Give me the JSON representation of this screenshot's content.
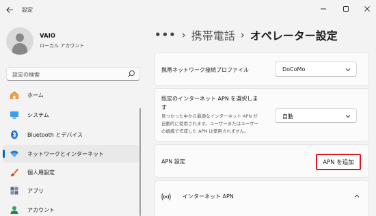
{
  "window": {
    "title": "設定",
    "back_icon": "arrow-left-icon",
    "controls": [
      "minimize-icon",
      "maximize-icon",
      "close-icon"
    ]
  },
  "user": {
    "name": "VAIO",
    "account_type": "ローカル アカウント"
  },
  "search": {
    "placeholder": "設定の検索"
  },
  "sidebar": {
    "items": [
      {
        "label": "ホーム",
        "icon": "home-icon"
      },
      {
        "label": "システム",
        "icon": "system-icon"
      },
      {
        "label": "Bluetooth とデバイス",
        "icon": "bluetooth-icon"
      },
      {
        "label": "ネットワークとインターネット",
        "icon": "wifi-icon",
        "selected": true
      },
      {
        "label": "個人用設定",
        "icon": "brush-icon"
      },
      {
        "label": "アプリ",
        "icon": "apps-icon"
      },
      {
        "label": "アカウント",
        "icon": "account-icon"
      }
    ],
    "accent_color": "#0067c0"
  },
  "breadcrumb": {
    "more": "•••",
    "parent": "携帯電話",
    "current": "オペレーター設定"
  },
  "settings": {
    "profile": {
      "label": "携帯ネットワーク接続プロファイル",
      "value": "DoCoMo"
    },
    "default_apn": {
      "label_line1": "既定のインターネット APN を選択しま",
      "label_line2": "す",
      "desc_line1": "見つかった中から最適なインターネット APN が",
      "desc_line2": "自動的に使用されます。ユーザーまたはユーザー",
      "desc_line3": "の組織で作成した APN は使用されません。",
      "value": "自動"
    },
    "apn": {
      "label": "APN 設定",
      "button": "APN を追加",
      "highlight_color": "#e0141e"
    },
    "internet_apn": {
      "label": "インターネット APN",
      "icon": "antenna-icon",
      "chevron": "chevron-up-icon"
    }
  }
}
